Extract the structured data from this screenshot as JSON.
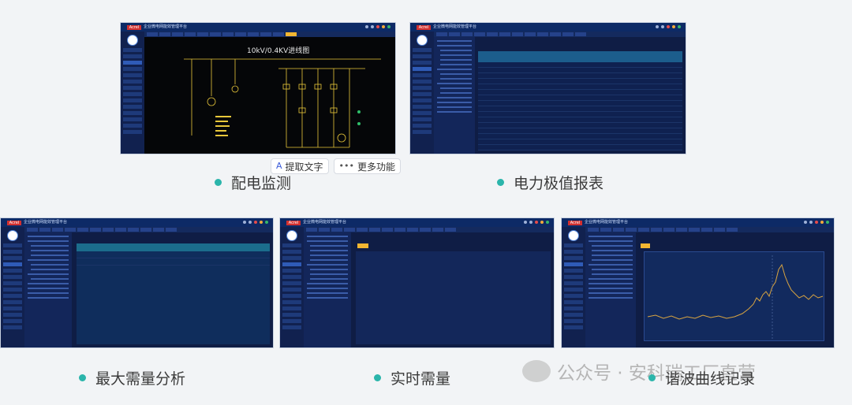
{
  "panels": [
    {
      "caption": "配电监测",
      "diagram_title": "10kV/0.4KV进线图",
      "app_title": "企业微电网能效管理平台"
    },
    {
      "caption": "电力极值报表",
      "app_title": "企业微电网能效管理平台"
    },
    {
      "caption": "最大需量分析",
      "app_title": "企业微电网能效管理平台"
    },
    {
      "caption": "实时需量",
      "app_title": "企业微电网能效管理平台"
    },
    {
      "caption": "谐波曲线记录",
      "app_title": "企业微电网能效管理平台"
    }
  ],
  "brand_logo": "Acrel",
  "hover_menu": {
    "extract_text": "提取文字",
    "more_functions": "更多功能"
  },
  "watermark": "公众号 · 安科瑞工厂直营",
  "colors": {
    "accent_teal": "#2bb5ab",
    "panel_bg": "#0f1d45",
    "highlight_yellow": "#f2b632",
    "harmonic_line": "#d9a441"
  }
}
